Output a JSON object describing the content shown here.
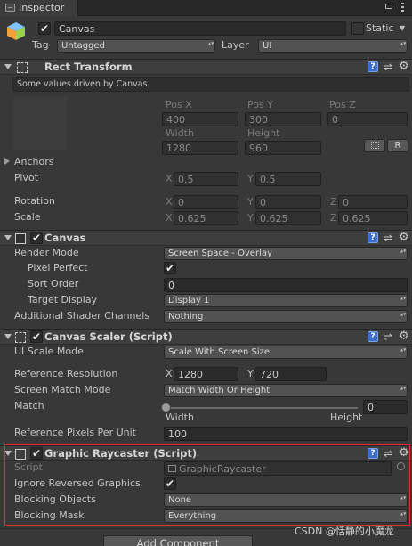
{
  "window": {
    "tab_label": "Inspector"
  },
  "gameobject": {
    "active": true,
    "name": "Canvas",
    "static_label": "Static",
    "static_checked": false,
    "tag_label": "Tag",
    "tag_value": "Untagged",
    "layer_label": "Layer",
    "layer_value": "UI"
  },
  "rect_transform": {
    "title": "Rect Transform",
    "info": "Some values driven by Canvas.",
    "pos_x_label": "Pos X",
    "pos_x": "400",
    "pos_y_label": "Pos Y",
    "pos_y": "300",
    "pos_z_label": "Pos Z",
    "pos_z": "0",
    "width_label": "Width",
    "width": "1280",
    "height_label": "Height",
    "height": "960",
    "r_button": "R",
    "anchors_label": "Anchors",
    "pivot_label": "Pivot",
    "pivot_x_label": "X",
    "pivot_x": "0.5",
    "pivot_y_label": "Y",
    "pivot_y": "0.5",
    "rotation_label": "Rotation",
    "rot_x_label": "X",
    "rot_x": "0",
    "rot_y_label": "Y",
    "rot_y": "0",
    "rot_z_label": "Z",
    "rot_z": "0",
    "scale_label": "Scale",
    "scale_x_label": "X",
    "scale_x": "0.625",
    "scale_y_label": "Y",
    "scale_y": "0.625",
    "scale_z_label": "Z",
    "scale_z": "0.625"
  },
  "canvas": {
    "title": "Canvas",
    "enabled": true,
    "render_mode_label": "Render Mode",
    "render_mode": "Screen Space - Overlay",
    "pixel_perfect_label": "Pixel Perfect",
    "pixel_perfect": true,
    "sort_order_label": "Sort Order",
    "sort_order": "0",
    "target_display_label": "Target Display",
    "target_display": "Display 1",
    "shader_channels_label": "Additional Shader Channels",
    "shader_channels": "Nothing"
  },
  "canvas_scaler": {
    "title": "Canvas Scaler (Script)",
    "enabled": true,
    "ui_scale_mode_label": "UI Scale Mode",
    "ui_scale_mode": "Scale With Screen Size",
    "ref_res_label": "Reference Resolution",
    "ref_x_label": "X",
    "ref_x": "1280",
    "ref_y_label": "Y",
    "ref_y": "720",
    "match_mode_label": "Screen Match Mode",
    "match_mode": "Match Width Or Height",
    "match_label": "Match",
    "match_value": "0",
    "match_fraction": 0,
    "match_left": "Width",
    "match_right": "Height",
    "ppu_label": "Reference Pixels Per Unit",
    "ppu": "100"
  },
  "graphic_raycaster": {
    "title": "Graphic Raycaster (Script)",
    "enabled": true,
    "script_label": "Script",
    "script_value": "GraphicRaycaster",
    "ignore_reversed_label": "Ignore Reversed Graphics",
    "ignore_reversed": true,
    "blocking_objects_label": "Blocking Objects",
    "blocking_objects": "None",
    "blocking_mask_label": "Blocking Mask",
    "blocking_mask": "Everything",
    "highlight_color": "#d9302c"
  },
  "add_component": "Add Component",
  "watermark": "CSDN @恬静的小魔龙",
  "colors": {
    "accent_blue": "#3b6ec8",
    "background": "#383838",
    "header": "#3e3e3e"
  }
}
